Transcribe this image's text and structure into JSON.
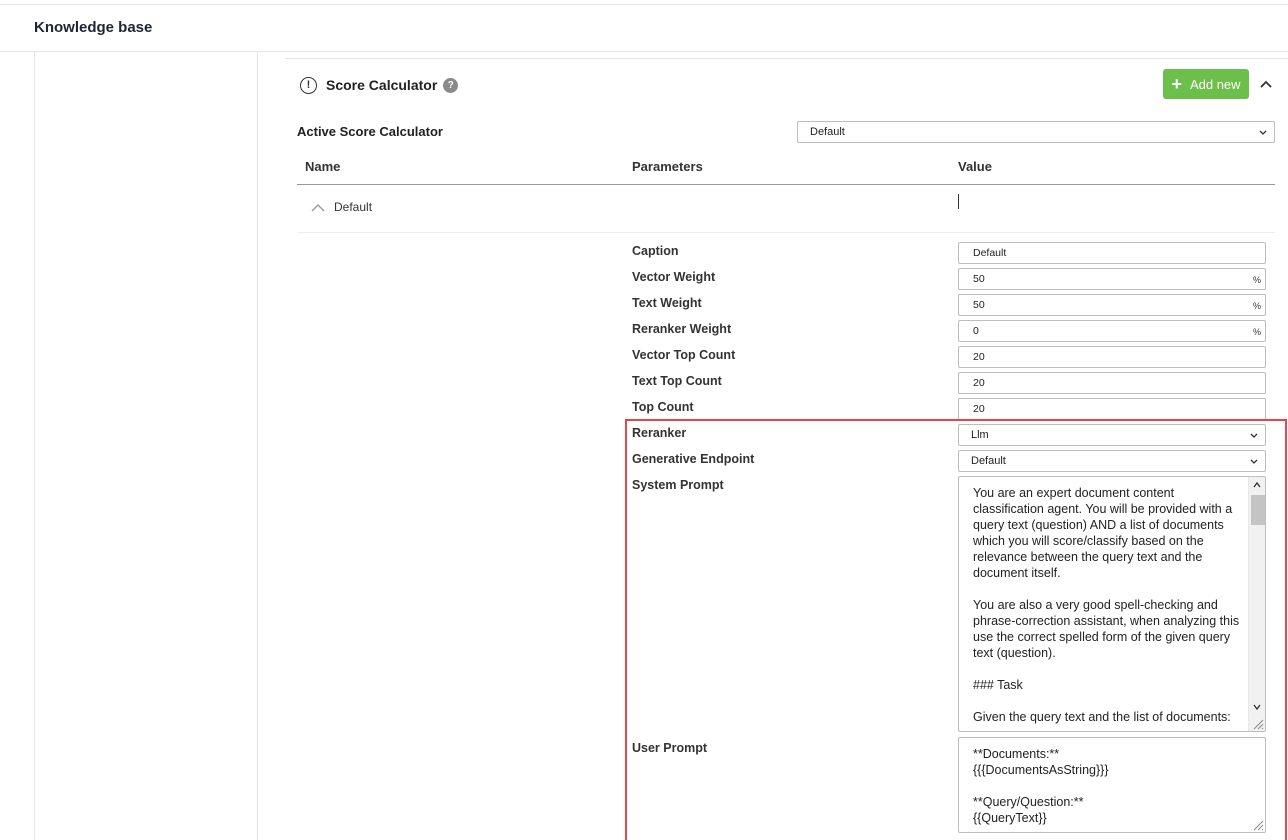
{
  "header": {
    "title": "Knowledge base"
  },
  "section": {
    "title": "Score Calculator",
    "help_glyph": "?",
    "alert_glyph": "!",
    "add_new_label": "Add new",
    "add_glyph": "+"
  },
  "active_calculator": {
    "label": "Active Score Calculator",
    "selected": "Default"
  },
  "table": {
    "columns": [
      "Name",
      "Parameters",
      "Value"
    ],
    "row": {
      "name": "Default"
    }
  },
  "params": {
    "caption": {
      "label": "Caption",
      "value": "Default"
    },
    "vector_weight": {
      "label": "Vector Weight",
      "value": "50",
      "unit": "%"
    },
    "text_weight": {
      "label": "Text Weight",
      "value": "50",
      "unit": "%"
    },
    "reranker_weight": {
      "label": "Reranker Weight",
      "value": "0",
      "unit": "%"
    },
    "vector_top_count": {
      "label": "Vector Top Count",
      "value": "20"
    },
    "text_top_count": {
      "label": "Text Top Count",
      "value": "20"
    },
    "top_count": {
      "label": "Top Count",
      "value": "20"
    },
    "reranker": {
      "label": "Reranker",
      "value": "Llm"
    },
    "generative_endpoint": {
      "label": "Generative Endpoint",
      "value": "Default"
    },
    "system_prompt": {
      "label": "System Prompt",
      "value": "You are an expert document content classification agent. You will be provided with a query text (question) AND a list of documents which you will score/classify based on the relevance between the query text and the document itself.\n\nYou are also a very good spell-checking and phrase-correction assistant, when analyzing this use the correct spelled form of the given query text (question).\n\n### Task\n\nGiven the query text and the list of documents:"
    },
    "user_prompt": {
      "label": "User Prompt",
      "value": "**Documents:**\n{{{DocumentsAsString}}}\n\n**Query/Question:**\n{{QueryText}}"
    }
  },
  "colors": {
    "accent_green": "#6dbf4b",
    "highlight_red": "#e2474b"
  }
}
